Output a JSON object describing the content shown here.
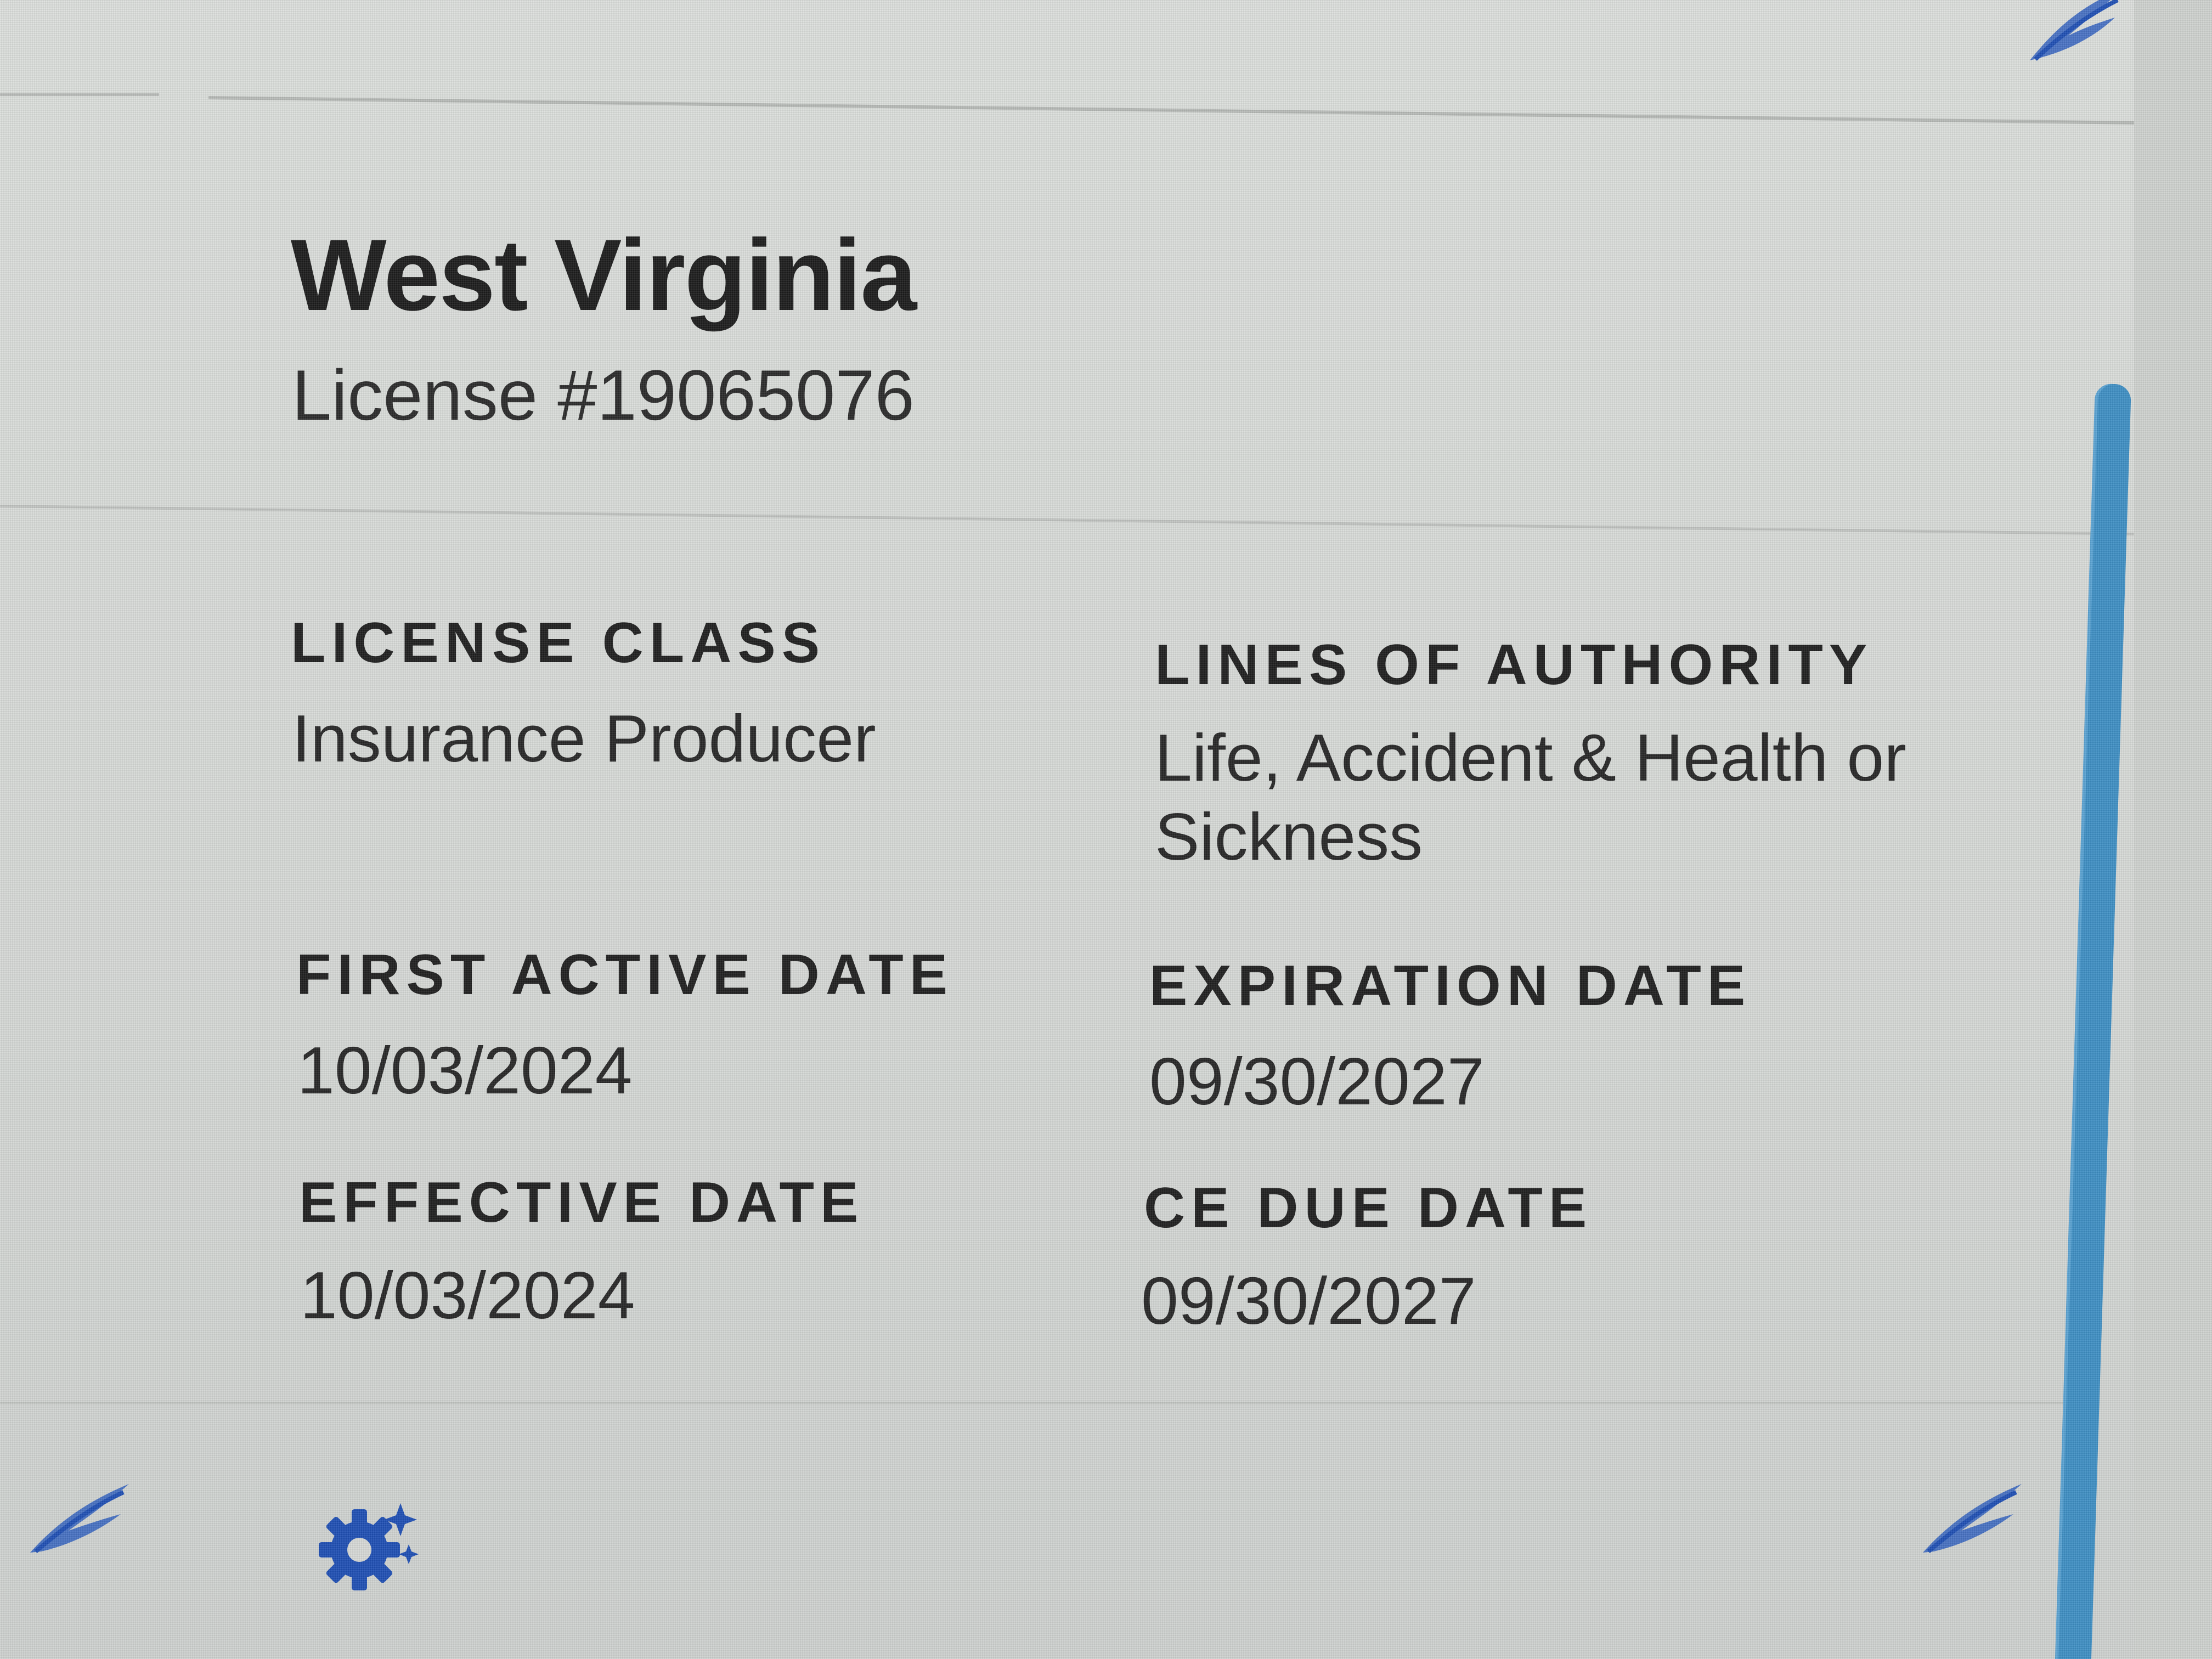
{
  "license": {
    "state": "West Virginia",
    "number_label": "License #19065076"
  },
  "fields": {
    "license_class": {
      "label": "LICENSE CLASS",
      "value": "Insurance Producer"
    },
    "lines_of_authority": {
      "label": "LINES OF AUTHORITY",
      "value": "Life, Accident & Health or Sickness"
    },
    "first_active_date": {
      "label": "FIRST ACTIVE DATE",
      "value": "10/03/2024"
    },
    "expiration_date": {
      "label": "EXPIRATION DATE",
      "value": "09/30/2027"
    },
    "effective_date": {
      "label": "EFFECTIVE DATE",
      "value": "10/03/2024"
    },
    "ce_due_date": {
      "label": "CE DUE DATE",
      "value": "09/30/2027"
    }
  },
  "icons": {
    "corner_logo": "feather-logo-icon",
    "settings": "gear-sparkle-icon"
  },
  "colors": {
    "accent_blue": "#1f4fb4",
    "scrollbar_blue": "#3e8fc4",
    "text_dark": "#1c1c1c"
  }
}
